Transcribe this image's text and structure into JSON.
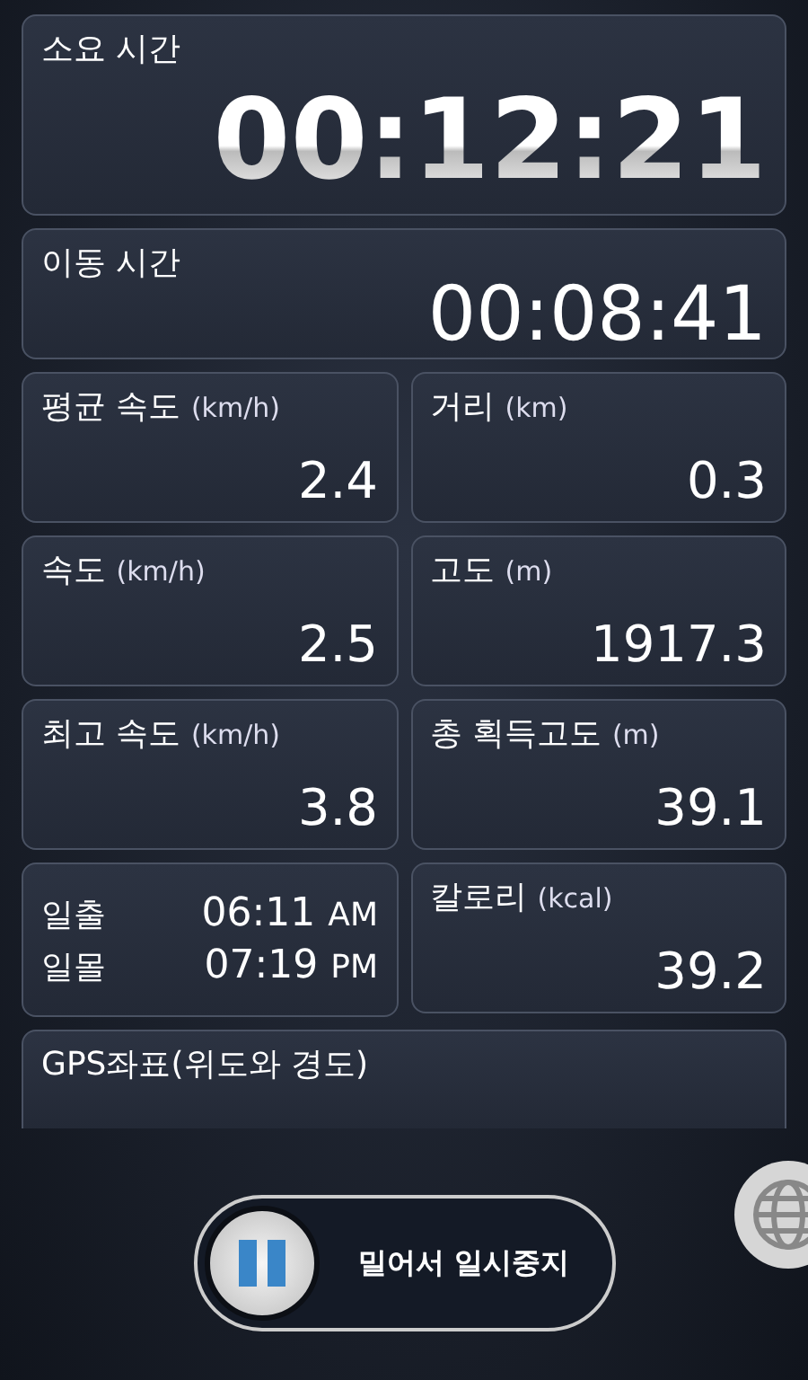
{
  "elapsed": {
    "label": "소요 시간",
    "value": "00:12:21"
  },
  "moving": {
    "label": "이동 시간",
    "value": "00:08:41"
  },
  "stats": [
    {
      "kind": "stat",
      "label": "평균 속도",
      "unit": "(km/h)",
      "value": "2.4"
    },
    {
      "kind": "stat",
      "label": "거리",
      "unit": "(km)",
      "value": "0.3"
    },
    {
      "kind": "stat",
      "label": "속도",
      "unit": "(km/h)",
      "value": "2.5"
    },
    {
      "kind": "stat",
      "label": "고도",
      "unit": "(m)",
      "value": "1917.3"
    },
    {
      "kind": "stat",
      "label": "최고 속도",
      "unit": "(km/h)",
      "value": "3.8"
    },
    {
      "kind": "stat",
      "label": "총 획득고도",
      "unit": "(m)",
      "value": "39.1"
    },
    {
      "kind": "sun",
      "rows": [
        {
          "label": "일출",
          "time": "06:11",
          "suffix": "AM"
        },
        {
          "label": "일몰",
          "time": "07:19",
          "suffix": "PM"
        }
      ]
    },
    {
      "kind": "stat",
      "label": "칼로리",
      "unit": "(kcal)",
      "value": "39.2"
    }
  ],
  "gps": {
    "label": "GPS좌표(위도와 경도)"
  },
  "pause_slider": {
    "label": "밀어서 일시중지",
    "level": 0
  }
}
